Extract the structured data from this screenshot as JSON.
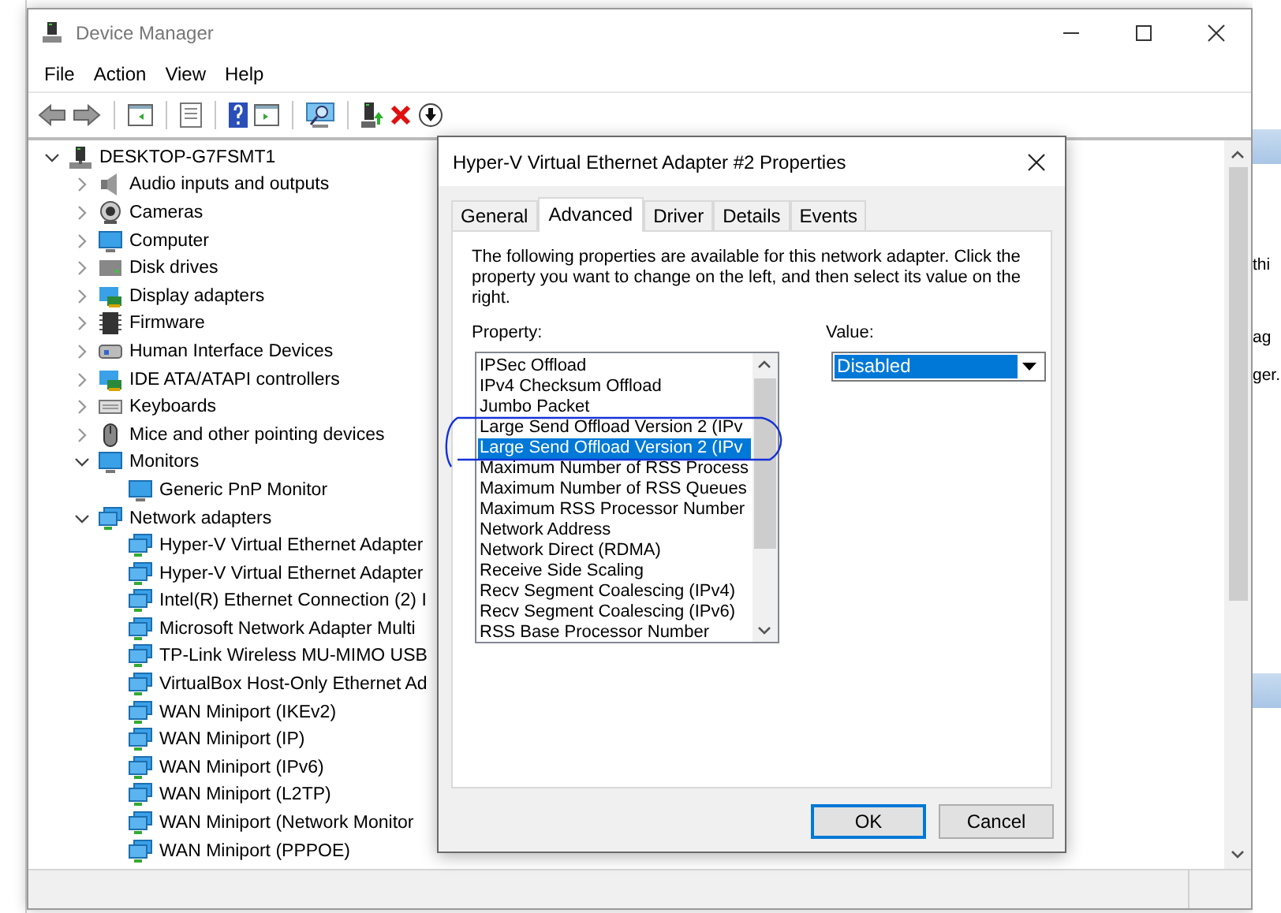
{
  "window": {
    "title": "Device Manager",
    "menu": [
      "File",
      "Action",
      "View",
      "Help"
    ]
  },
  "tree": {
    "label": "DESKTOP-G7FSMT1",
    "expanded": true,
    "children": [
      {
        "label": "Audio inputs and outputs",
        "expanded": false
      },
      {
        "label": "Cameras",
        "expanded": false
      },
      {
        "label": "Computer",
        "expanded": false
      },
      {
        "label": "Disk drives",
        "expanded": false
      },
      {
        "label": "Display adapters",
        "expanded": false
      },
      {
        "label": "Firmware",
        "expanded": false
      },
      {
        "label": "Human Interface Devices",
        "expanded": false
      },
      {
        "label": "IDE ATA/ATAPI controllers",
        "expanded": false
      },
      {
        "label": "Keyboards",
        "expanded": false
      },
      {
        "label": "Mice and other pointing devices",
        "expanded": false
      },
      {
        "label": "Monitors",
        "expanded": true,
        "children": [
          {
            "label": "Generic PnP Monitor"
          }
        ]
      },
      {
        "label": "Network adapters",
        "expanded": true,
        "children": [
          {
            "label": "Hyper-V Virtual Ethernet Adapter"
          },
          {
            "label": "Hyper-V Virtual Ethernet Adapter"
          },
          {
            "label": "Intel(R) Ethernet Connection (2) I"
          },
          {
            "label": "Microsoft Network Adapter Multi"
          },
          {
            "label": "TP-Link Wireless MU-MIMO USB"
          },
          {
            "label": "VirtualBox Host-Only Ethernet Ad"
          },
          {
            "label": "WAN Miniport (IKEv2)"
          },
          {
            "label": "WAN Miniport (IP)"
          },
          {
            "label": "WAN Miniport (IPv6)"
          },
          {
            "label": "WAN Miniport (L2TP)"
          },
          {
            "label": "WAN Miniport (Network Monitor"
          },
          {
            "label": "WAN Miniport (PPPOE)"
          }
        ]
      }
    ]
  },
  "dialog": {
    "title": "Hyper-V Virtual Ethernet Adapter #2 Properties",
    "tabs": [
      {
        "label": "General",
        "selected": false
      },
      {
        "label": "Advanced",
        "selected": true
      },
      {
        "label": "Driver",
        "selected": false
      },
      {
        "label": "Details",
        "selected": false
      },
      {
        "label": "Events",
        "selected": false
      }
    ],
    "description": "The following properties are available for this network adapter. Click the property you want to change on the left, and then select its value on the right.",
    "property_label": "Property:",
    "properties": [
      {
        "label": "IPSec Offload",
        "selected": false
      },
      {
        "label": "IPv4 Checksum Offload",
        "selected": false
      },
      {
        "label": "Jumbo Packet",
        "selected": false
      },
      {
        "label": "Large Send Offload Version 2 (IPv",
        "selected": false
      },
      {
        "label": "Large Send Offload Version 2 (IPv",
        "selected": true
      },
      {
        "label": "Maximum Number of RSS Process",
        "selected": false
      },
      {
        "label": "Maximum Number of RSS Queues",
        "selected": false
      },
      {
        "label": "Maximum RSS Processor Number",
        "selected": false
      },
      {
        "label": "Network Address",
        "selected": false
      },
      {
        "label": "Network Direct (RDMA)",
        "selected": false
      },
      {
        "label": "Receive Side Scaling",
        "selected": false
      },
      {
        "label": "Recv Segment Coalescing (IPv4)",
        "selected": false
      },
      {
        "label": "Recv Segment Coalescing (IPv6)",
        "selected": false
      },
      {
        "label": "RSS Base Processor Number",
        "selected": false
      }
    ],
    "value_label": "Value:",
    "value": "Disabled",
    "buttons": [
      "OK",
      "Cancel"
    ]
  },
  "background_window": {
    "texts": [
      "thi",
      "ag",
      "ger."
    ]
  }
}
